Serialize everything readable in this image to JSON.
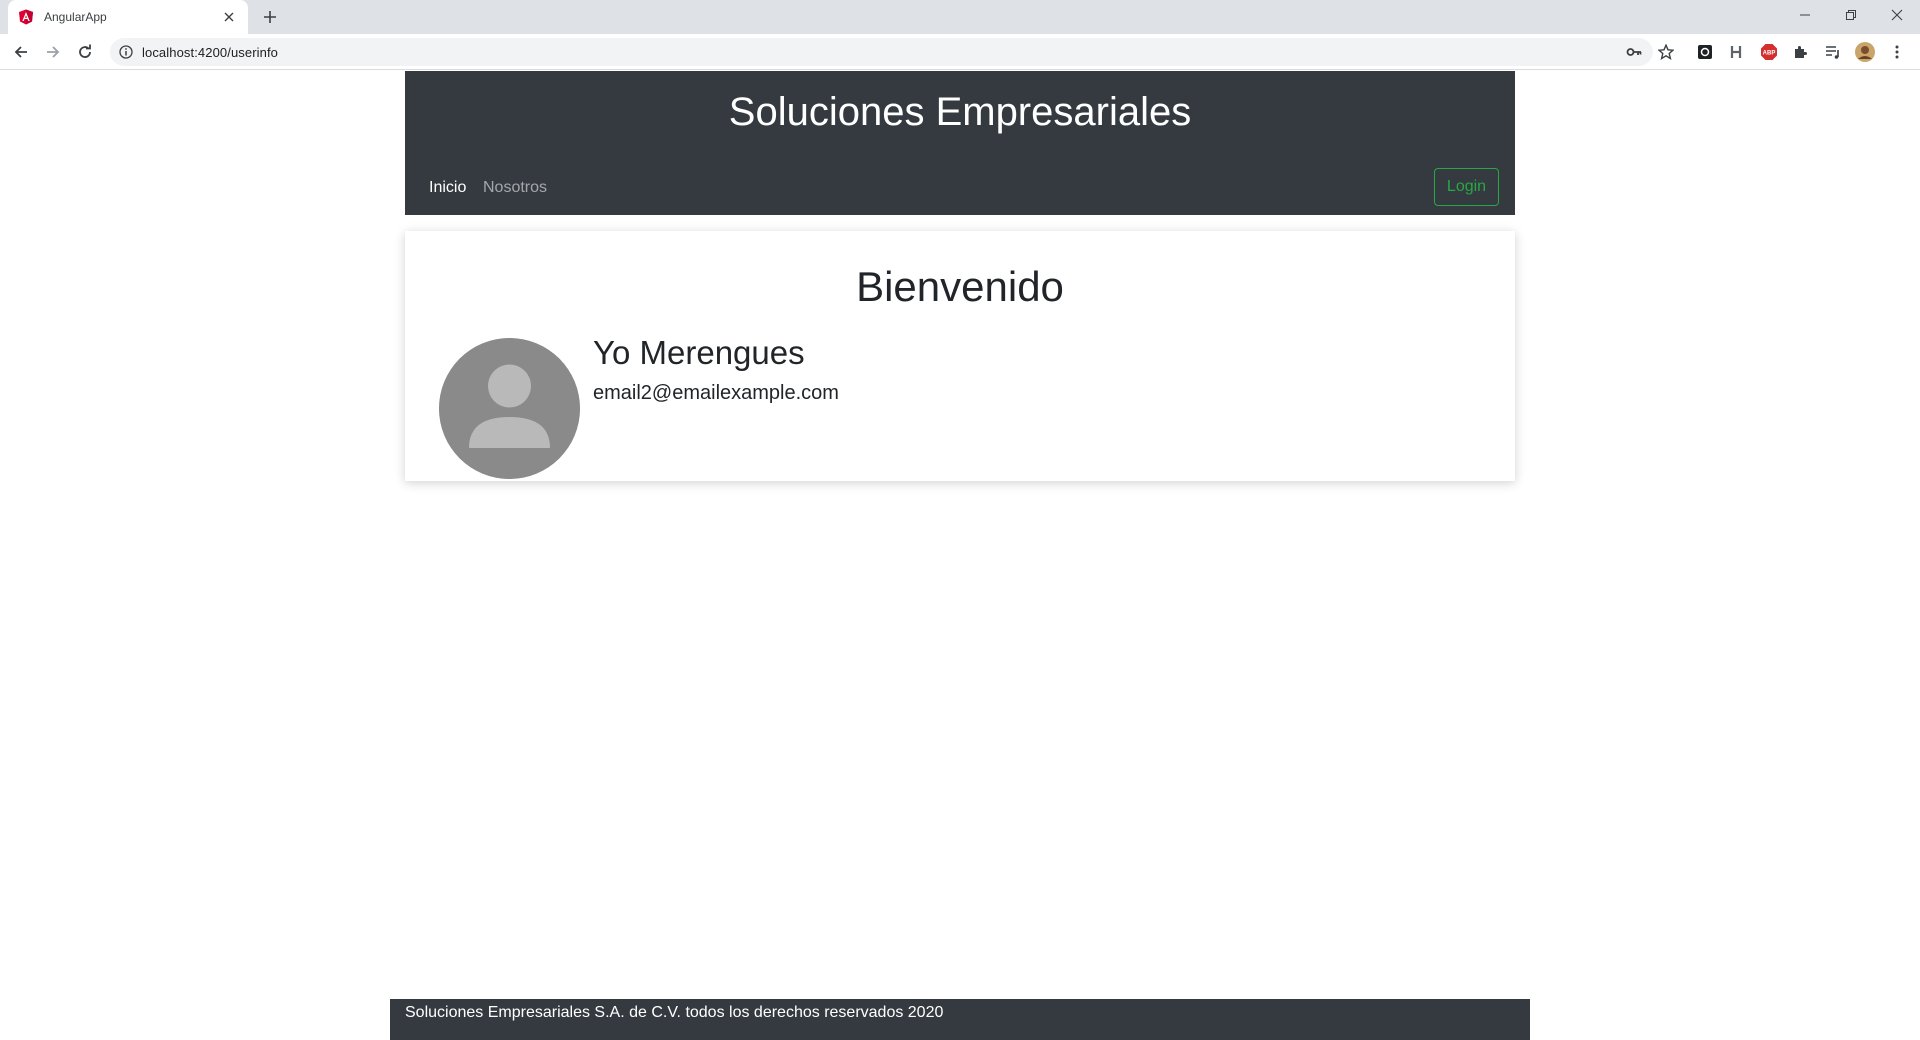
{
  "browser": {
    "tab_title": "AngularApp",
    "url": "localhost:4200/userinfo",
    "icons": [
      "angular-favicon",
      "close-icon",
      "plus-icon",
      "minimize-icon",
      "restore-icon",
      "window-close-icon",
      "back-arrow-icon",
      "forward-arrow-icon",
      "reload-icon",
      "info-icon",
      "key-icon",
      "star-icon",
      "extension-icons",
      "puzzle-icon",
      "media-icon",
      "profile-avatar",
      "kebab-menu-icon"
    ],
    "abp_label": "ABP"
  },
  "header": {
    "title": "Soluciones Empresariales",
    "nav": [
      {
        "label": "Inicio",
        "active": true
      },
      {
        "label": "Nosotros",
        "active": false
      }
    ],
    "login_label": "Login",
    "background": "#343a40",
    "accent": "#28a745"
  },
  "main": {
    "welcome": "Bienvenido",
    "user": {
      "name": "Yo Merengues",
      "email": "email2@emailexample.com"
    }
  },
  "footer": {
    "text": "Soluciones Empresariales S.A. de C.V. todos los derechos reservados 2020"
  }
}
